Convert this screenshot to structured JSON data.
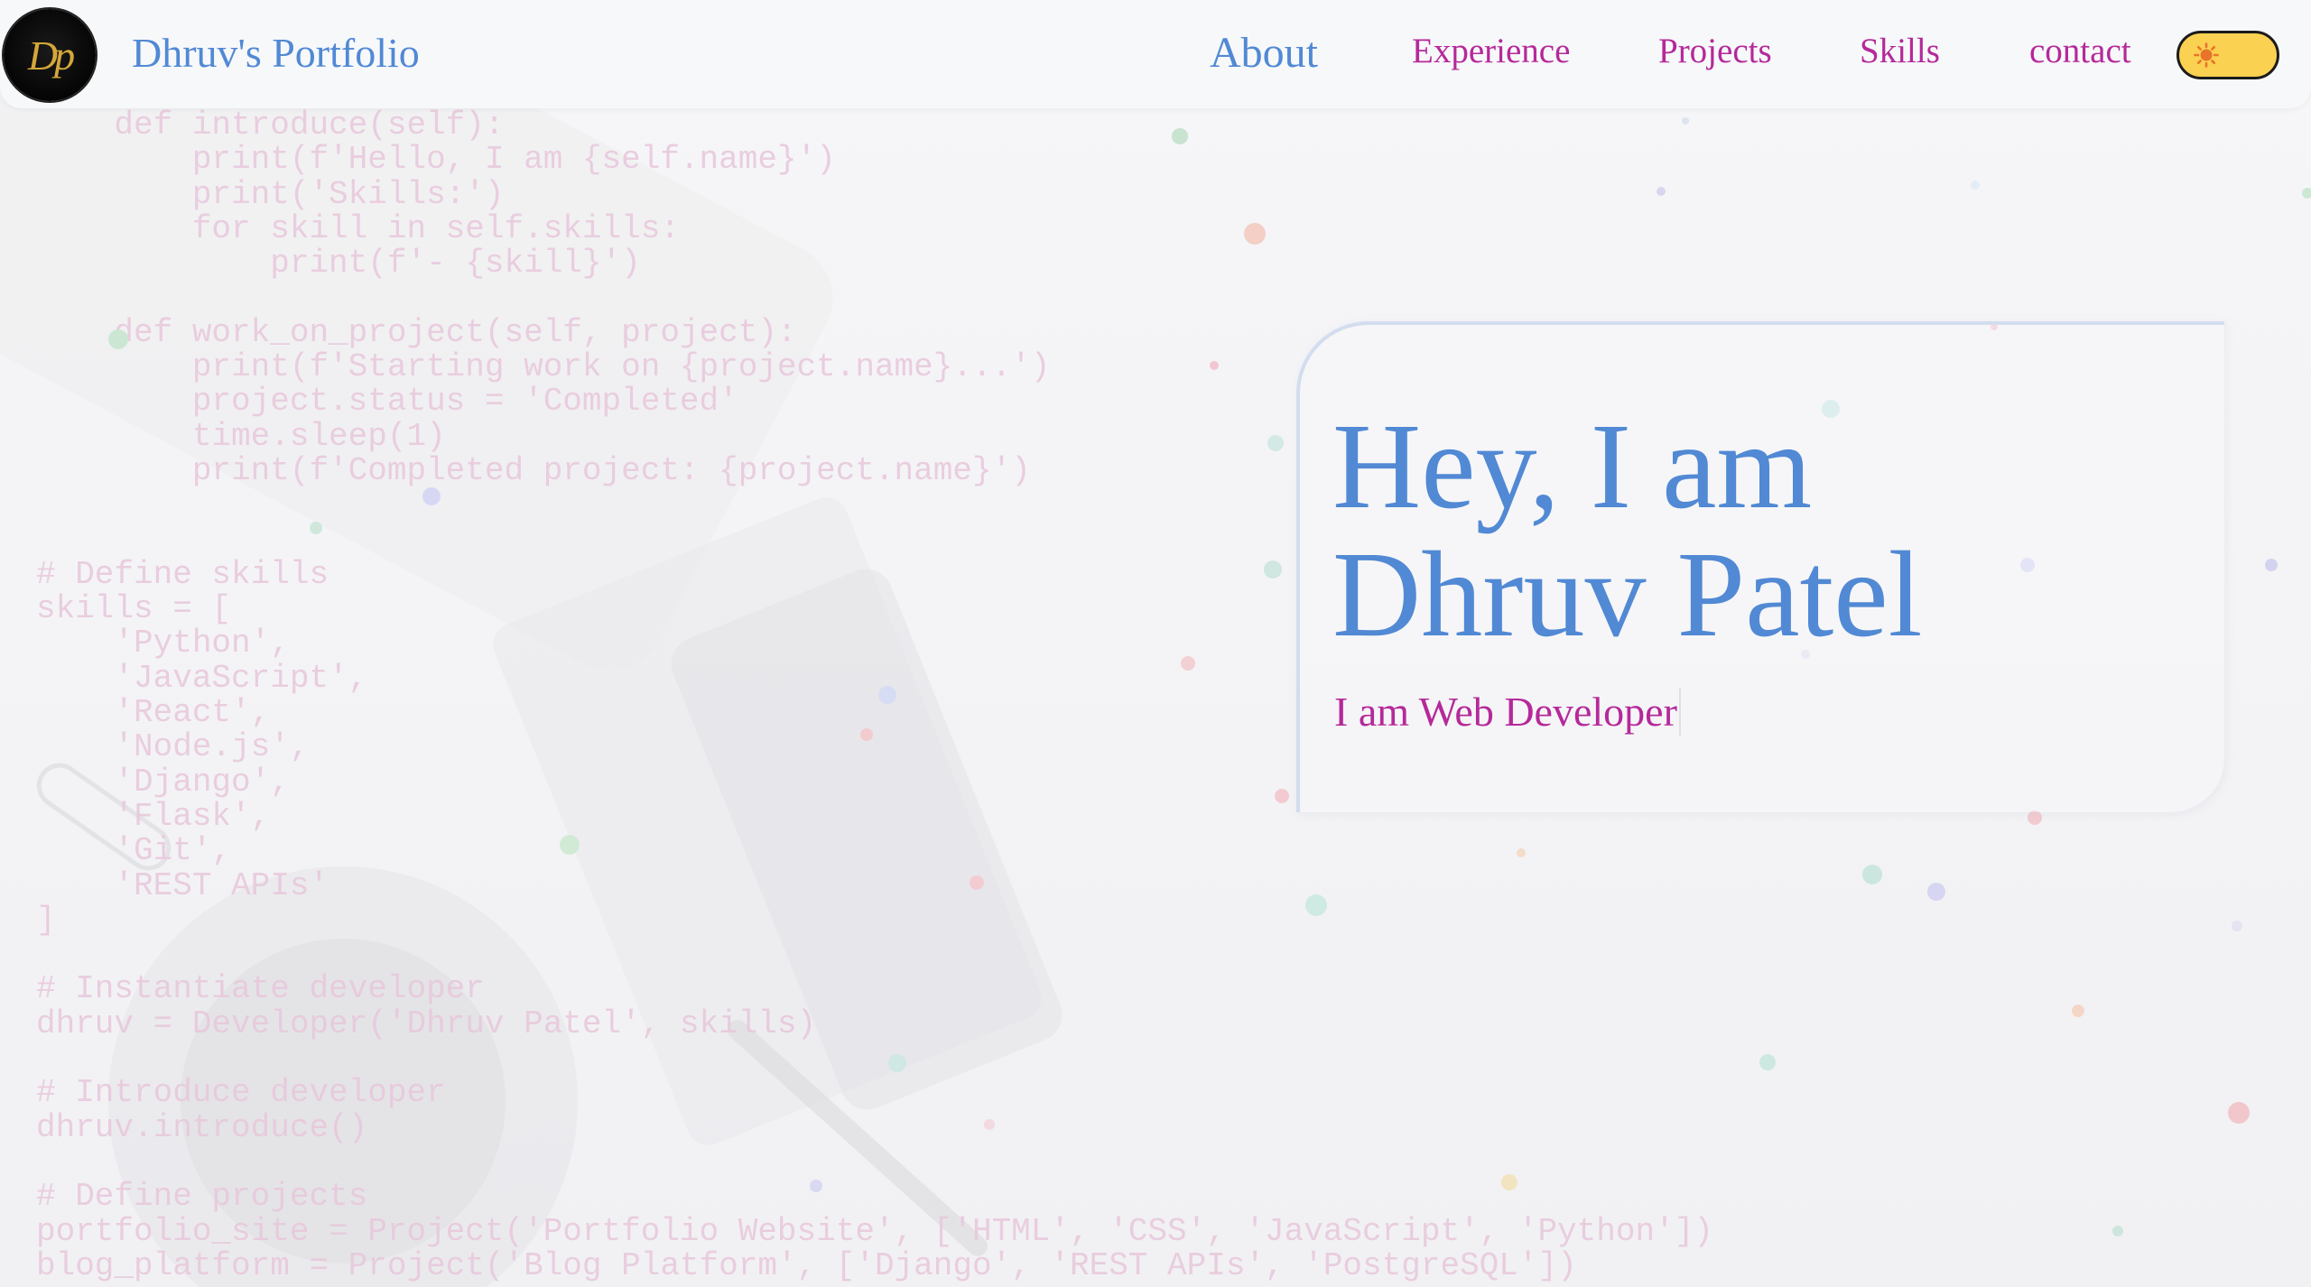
{
  "navbar": {
    "logo_text": "Dp",
    "brand": "Dhruv's Portfolio",
    "links": [
      {
        "label": "About"
      },
      {
        "label": "Experience"
      },
      {
        "label": "Projects"
      },
      {
        "label": "Skills"
      },
      {
        "label": "contact"
      }
    ],
    "active_link": "About",
    "theme_toggle_icon": "sun-icon"
  },
  "hero": {
    "title_line1": "Hey, I am",
    "title_line2": "Dhruv Patel",
    "subtitle": "I am Web Developer"
  },
  "background_code": "    def introduce(self):\n        print(f'Hello, I am {self.name}')\n        print('Skills:')\n        for skill in self.skills:\n            print(f'- {skill}')\n\n    def work_on_project(self, project):\n        print(f'Starting work on {project.name}...')\n        project.status = 'Completed'\n        time.sleep(1)\n        print(f'Completed project: {project.name}')\n\n\n# Define skills\nskills = [\n    'Python',\n    'JavaScript',\n    'React',\n    'Node.js',\n    'Django',\n    'Flask',\n    'Git',\n    'REST APIs'\n]\n\n# Instantiate developer\ndhruv = Developer('Dhruv Patel', skills)\n\n# Introduce developer\ndhruv.introduce()\n\n# Define projects\nportfolio_site = Project('Portfolio Website', ['HTML', 'CSS', 'JavaScript', 'Python'])\nblog_platform = Project('Blog Platform', ['Django', 'REST APIs', 'PostgreSQL'])",
  "colors": {
    "brand_blue": "#5189d4",
    "accent_magenta": "#b5299a",
    "toggle_yellow": "#fbd151",
    "code_pink": "#e8c7dc"
  }
}
